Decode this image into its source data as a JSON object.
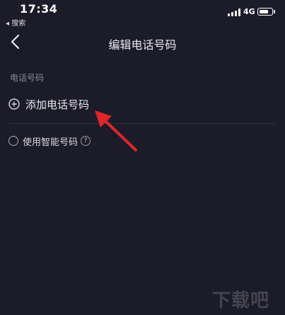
{
  "status_bar": {
    "time": "17:34",
    "back_app": "◂ 搜索",
    "network": "4G"
  },
  "nav": {
    "title": "编辑电话号码",
    "back_icon": "chevron-left-icon"
  },
  "section": {
    "label": "电话号码",
    "add_phone_label": "添加电话号码",
    "smart_number_label": "使用智能号码",
    "help_glyph": "?"
  },
  "annotation": {
    "arrow_color": "#e0262a"
  },
  "watermark": {
    "text": "下载吧"
  }
}
